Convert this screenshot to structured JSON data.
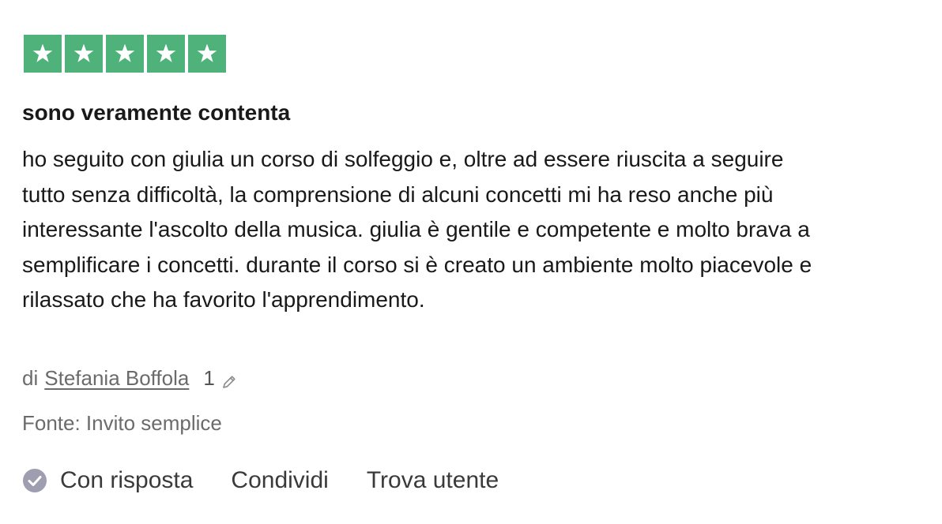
{
  "rating": {
    "stars": 5,
    "max": 5,
    "color": "#4fb27a",
    "icon": "star-icon"
  },
  "review": {
    "title": "sono veramente contenta",
    "lines": [
      "ho seguito con giulia un corso di solfeggio e, oltre ad essere riuscita a seguire",
      "tutto senza difficoltà, la comprensione di alcuni concetti mi ha reso anche più",
      "interessante l'ascolto della musica. giulia è gentile e competente e molto brava a",
      "semplificare i concetti. durante il corso si è creato un ambiente molto piacevole e",
      "rilassato che ha favorito l'apprendimento."
    ]
  },
  "byline": {
    "prefix": "di",
    "author": "Stefania Boffola",
    "review_count": "1",
    "edit_icon": "pencil-icon"
  },
  "source": {
    "label": "Fonte: Invito semplice"
  },
  "actions": {
    "replied_icon": "check-circle-icon",
    "replied": "Con risposta",
    "share": "Condividi",
    "find_user": "Trova utente"
  }
}
